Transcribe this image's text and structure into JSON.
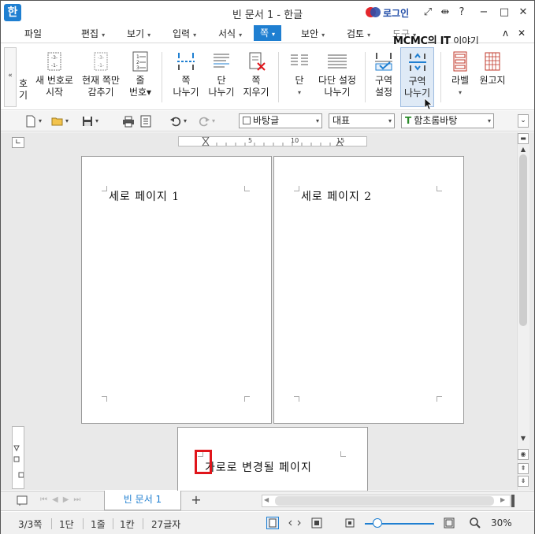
{
  "window": {
    "app_logo": "한",
    "title": "빈 문서 1 - 한글",
    "login_label": "로그인",
    "controls": [
      "⤢",
      "⇹",
      "?",
      "−",
      "□",
      "✕"
    ]
  },
  "menu": {
    "items": [
      {
        "label": "파일",
        "arrow": ""
      },
      {
        "label": "편집",
        "arrow": "▾"
      },
      {
        "label": "보기",
        "arrow": "▾"
      },
      {
        "label": "입력",
        "arrow": "▾"
      },
      {
        "label": "서식",
        "arrow": "▾"
      },
      {
        "label": "쪽",
        "arrow": "▾"
      },
      {
        "label": "보안",
        "arrow": "▾"
      },
      {
        "label": "검토",
        "arrow": "▾"
      },
      {
        "label": "도구",
        "arrow": "▾"
      }
    ],
    "right_controls": [
      "ʌ",
      "✕"
    ],
    "watermark_bold": "MCMC의 IT",
    "watermark_rest": " 이야기"
  },
  "ribbon": {
    "collapse_label": "«",
    "cut_label_1": "호",
    "cut_label_2": "기",
    "buttons": [
      {
        "line1": "새 번호로",
        "line2": "시작"
      },
      {
        "line1": "현재 쪽만",
        "line2": "감추기"
      },
      {
        "line1": "줄",
        "line2": "번호▾"
      },
      {
        "line1": "쪽",
        "line2": "나누기"
      },
      {
        "line1": "단",
        "line2": "나누기"
      },
      {
        "line1": "쪽",
        "line2": "지우기"
      },
      {
        "line1": "단",
        "line2": "▾"
      },
      {
        "line1": "다단 설정",
        "line2": "나누기"
      },
      {
        "line1": "구역",
        "line2": "설정"
      },
      {
        "line1": "구역",
        "line2": "나누기"
      },
      {
        "line1": "라벨",
        "line2": "▾"
      },
      {
        "line1": "원고지",
        "line2": ""
      }
    ],
    "expand_label": "⌄"
  },
  "toolbar": {
    "style_value": "바탕글",
    "font_lang_value": "대표",
    "font_value": "함초롬바탕",
    "font_icon": "T"
  },
  "ruler": {
    "ticks": [
      "5",
      "10",
      "15"
    ]
  },
  "document": {
    "page1_text": "세로 페이지 1",
    "page2_text": "세로 페이지 2",
    "page3_text": "가로로 변경될 페이지"
  },
  "tabs": {
    "doc_tab": "빈 문서 1",
    "add_tab": "+"
  },
  "status": {
    "page": "3/3쪽",
    "column": "1단",
    "line": "1줄",
    "col": "1칸",
    "chars": "27글자",
    "zoom": "30%",
    "zoom_fraction": 0.3
  },
  "colors": {
    "accent": "#1f7fd1",
    "highlight": "#e0151b"
  }
}
